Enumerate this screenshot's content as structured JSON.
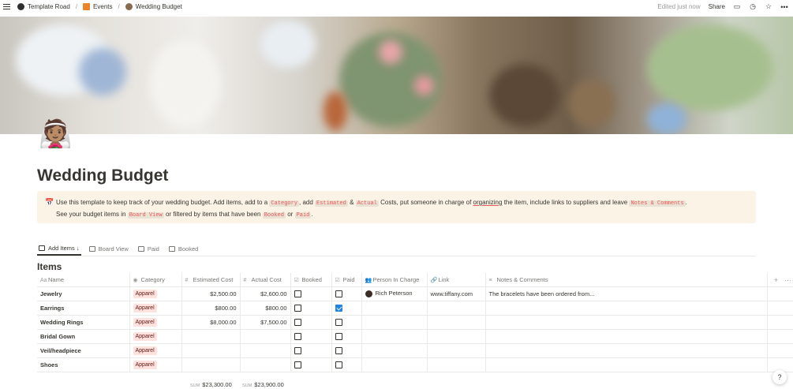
{
  "breadcrumb": [
    {
      "label": "Template Road",
      "icon": "template-road-icon"
    },
    {
      "label": "Events",
      "icon": "events-icon"
    },
    {
      "label": "Wedding Budget",
      "icon": "bride-icon"
    }
  ],
  "topbar": {
    "edited": "Edited just now",
    "share": "Share"
  },
  "page": {
    "icon": "👰🏽",
    "title": "Wedding Budget"
  },
  "callout": {
    "icon": "📅",
    "p1": "Use this template to keep track of your wedding budget. Add items, add to a",
    "code_category": "Category",
    "p2": ", add",
    "code_estimated": "Estimated",
    "amp": "&",
    "code_actual": "Actual",
    "p3": "Costs, put someone in charge of",
    "organizing": "organizing",
    "p4": "the item, include links to suppliers and leave",
    "code_notes": "Notes & Comments",
    "p5": ".",
    "p6": "See your budget items in",
    "code_board": "Board View",
    "p7": "or filtered by items that have been",
    "code_booked": "Booked",
    "or": "or",
    "code_paid": "Paid",
    "p8": "."
  },
  "tabs": [
    {
      "label": "Add Items ↓",
      "active": true
    },
    {
      "label": "Board View",
      "active": false
    },
    {
      "label": "Paid",
      "active": false
    },
    {
      "label": "Booked",
      "active": false
    }
  ],
  "db": {
    "title": "Items",
    "columns": [
      "Name",
      "Category",
      "Estimated Cost",
      "Actual Cost",
      "Booked",
      "Paid",
      "Person In Charge",
      "Link",
      "Notes & Comments"
    ],
    "rows": [
      {
        "name": "Jewelry",
        "category": "Apparel",
        "estimated": "$2,500.00",
        "actual": "$2,600.00",
        "booked": false,
        "paid": false,
        "person": "Rich Peterson",
        "link": "www.tiffany.com",
        "notes": "The bracelets have been ordered from..."
      },
      {
        "name": "Earrings",
        "category": "Apparel",
        "estimated": "$800.00",
        "actual": "$800.00",
        "booked": false,
        "paid": true,
        "person": "",
        "link": "",
        "notes": ""
      },
      {
        "name": "Wedding Rings",
        "category": "Apparel",
        "estimated": "$8,000.00",
        "actual": "$7,500.00",
        "booked": false,
        "paid": false,
        "person": "",
        "link": "",
        "notes": ""
      },
      {
        "name": "Bridal Gown",
        "category": "Apparel",
        "estimated": "",
        "actual": "",
        "booked": false,
        "paid": false,
        "person": "",
        "link": "",
        "notes": ""
      },
      {
        "name": "Veil/headpiece",
        "category": "Apparel",
        "estimated": "",
        "actual": "",
        "booked": false,
        "paid": false,
        "person": "",
        "link": "",
        "notes": ""
      },
      {
        "name": "Shoes",
        "category": "Apparel",
        "estimated": "",
        "actual": "",
        "booked": false,
        "paid": false,
        "person": "",
        "link": "",
        "notes": ""
      }
    ],
    "sum_label": "SUM",
    "sum_estimated": "$23,300.00",
    "sum_actual": "$23,900.00"
  },
  "help": "?"
}
